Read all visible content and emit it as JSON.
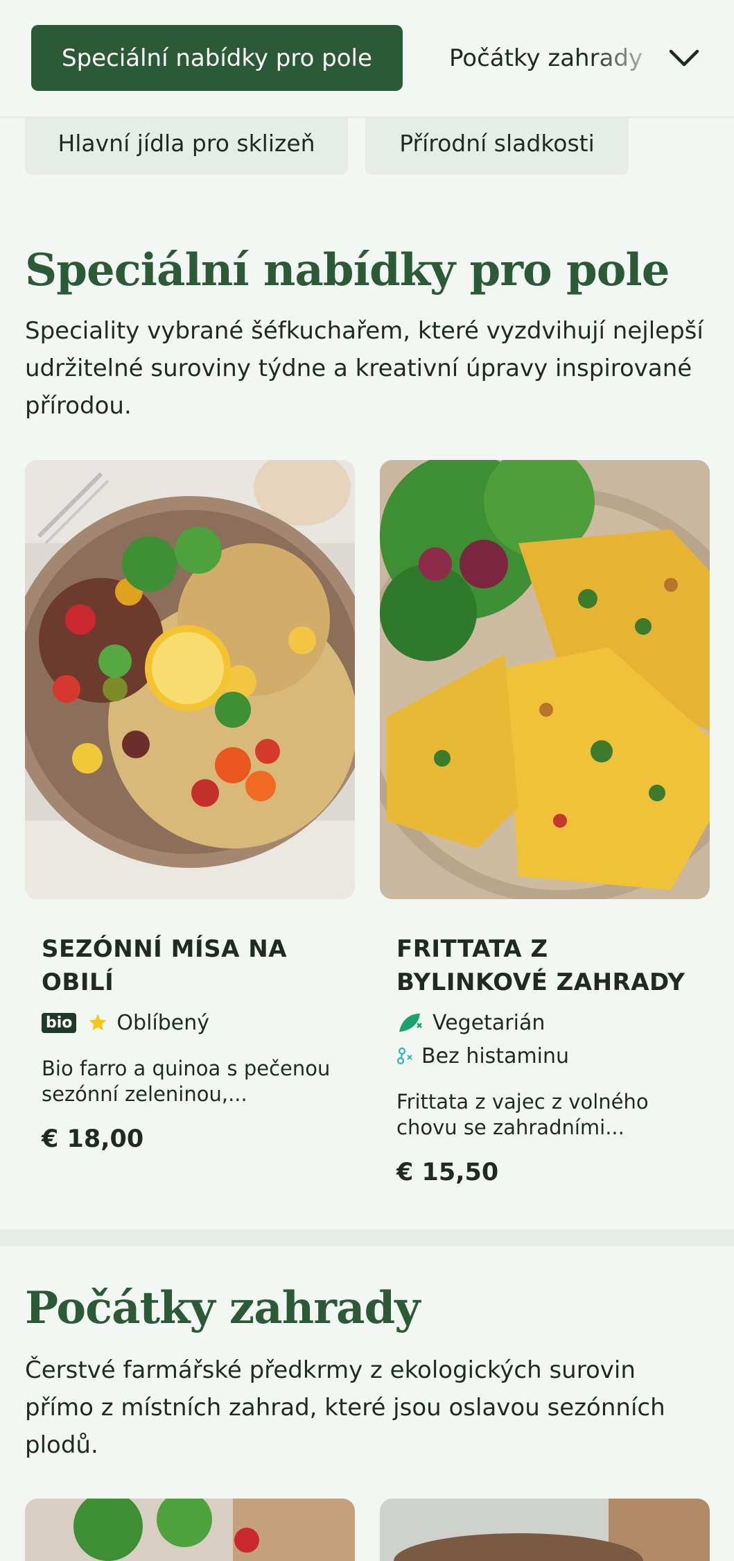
{
  "nav": {
    "active_label": "Speciální nabídky pro pole",
    "next_label": "Počátky zahrady",
    "categories": [
      "Hlavní jídla pro sklizeň",
      "Přírodní sladkosti"
    ]
  },
  "sections": [
    {
      "title": "Speciální nabídky pro pole",
      "description": "Speciality vybrané šéfkuchařem, které vyzdvihují nejlepší udržitelné suroviny týdne a kreativní úpravy inspirované přírodou.",
      "items": [
        {
          "name": "Sezónní mísa na obilí",
          "badge": "bio",
          "tags": [
            "Oblíbený"
          ],
          "description": "Bio farro a quinoa s pečenou sezónní zeleninou,...",
          "price": "€ 18,00"
        },
        {
          "name": "Frittata z bylinkové zahrady",
          "tags": [
            "Vegetarián",
            "Bez histaminu"
          ],
          "description": "Frittata z vajec z volného chovu se zahradními...",
          "price": "€ 15,50"
        }
      ]
    },
    {
      "title": "Počátky zahrady",
      "description": "Čerstvé farmářské předkrmy z ekologických surovin přímo z místních zahrad, které jsou oslavou sezónních plodů."
    }
  ],
  "colors": {
    "brand_green": "#2d5a36",
    "star": "#f5c518",
    "vegetarian_icon": "#1aa36a",
    "histamine_icon": "#2bb3c0"
  },
  "icons": [
    "chevron-down-icon",
    "star-icon",
    "leaf-icon",
    "histamine-free-icon"
  ]
}
